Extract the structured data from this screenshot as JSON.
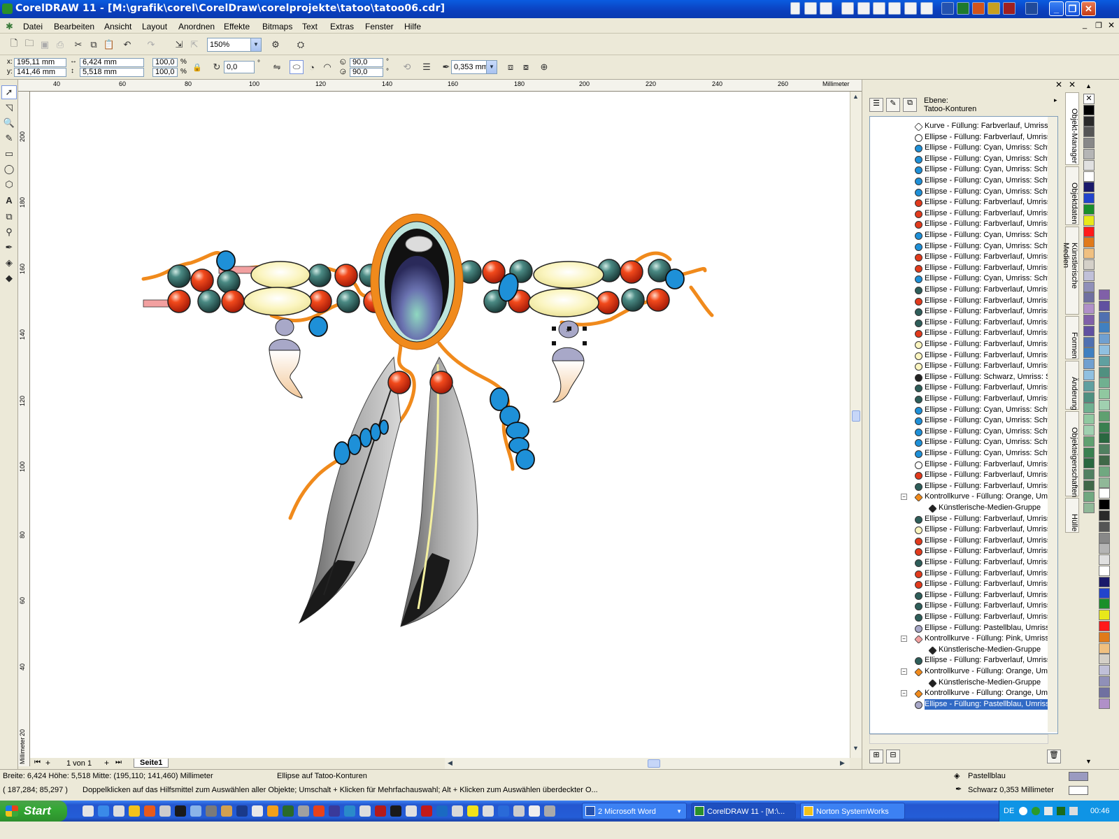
{
  "window": {
    "title": "CorelDRAW 11 - [M:\\grafik\\corel\\CorelDraw\\corelprojekte\\tatoo\\tatoo06.cdr]"
  },
  "menu": [
    "Datei",
    "Bearbeiten",
    "Ansicht",
    "Layout",
    "Anordnen",
    "Effekte",
    "Bitmaps",
    "Text",
    "Extras",
    "Fenster",
    "Hilfe"
  ],
  "toolbar": {
    "zoom": "150%",
    "x": "195,11 mm",
    "y": "141,46 mm",
    "width": "6,424 mm",
    "height": "5,518 mm",
    "scale_x": "100,0",
    "scale_y": "100,0",
    "percent": "%",
    "rotation": "0,0",
    "degree": "°",
    "arc_start": "90,0",
    "arc_end": "90,0",
    "outline_width": "0,353 mm"
  },
  "ruler": {
    "h_labels": [
      "40",
      "60",
      "80",
      "100",
      "120",
      "140",
      "160",
      "180",
      "200",
      "220",
      "240",
      "260",
      "Millimeter"
    ],
    "v_labels": [
      "200",
      "180",
      "160",
      "140",
      "120",
      "100",
      "80",
      "60",
      "40",
      "20",
      "Millimeter"
    ]
  },
  "pages": {
    "counter": "1 von 1",
    "tab": "Seite1"
  },
  "docker": {
    "layer_label": "Ebene:",
    "layer_name": "Tatoo-Konturen",
    "items": [
      {
        "text": "Kurve - Füllung: Farbverlauf, Umriss: S",
        "color": "#ffffff",
        "kind": "curve"
      },
      {
        "text": "Ellipse - Füllung: Farbverlauf, Umriss: S",
        "color": "#ffffff"
      },
      {
        "text": "Ellipse - Füllung: Cyan, Umriss: Schwarz",
        "color": "#1e90d8"
      },
      {
        "text": "Ellipse - Füllung: Cyan, Umriss: Schwarz",
        "color": "#1e90d8"
      },
      {
        "text": "Ellipse - Füllung: Cyan, Umriss: Schwarz",
        "color": "#1e90d8"
      },
      {
        "text": "Ellipse - Füllung: Cyan, Umriss: Schwarz",
        "color": "#1e90d8"
      },
      {
        "text": "Ellipse - Füllung: Cyan, Umriss: Schwarz",
        "color": "#1e90d8"
      },
      {
        "text": "Ellipse - Füllung: Farbverlauf, Umriss: S",
        "color": "#e23a1c"
      },
      {
        "text": "Ellipse - Füllung: Farbverlauf, Umriss: S",
        "color": "#e23a1c"
      },
      {
        "text": "Ellipse - Füllung: Farbverlauf, Umriss: S",
        "color": "#e23a1c"
      },
      {
        "text": "Ellipse - Füllung: Cyan, Umriss: Schwarz",
        "color": "#1e90d8"
      },
      {
        "text": "Ellipse - Füllung: Cyan, Umriss: Schwarz",
        "color": "#1e90d8"
      },
      {
        "text": "Ellipse - Füllung: Farbverlauf, Umriss: S",
        "color": "#e23a1c"
      },
      {
        "text": "Ellipse - Füllung: Farbverlauf, Umriss: S",
        "color": "#e23a1c"
      },
      {
        "text": "Ellipse - Füllung: Cyan, Umriss: Schwarz",
        "color": "#1e90d8"
      },
      {
        "text": "Ellipse - Füllung: Farbverlauf, Umriss: S",
        "color": "#2e5e5a"
      },
      {
        "text": "Ellipse - Füllung: Farbverlauf, Umriss: S",
        "color": "#e23a1c"
      },
      {
        "text": "Ellipse - Füllung: Farbverlauf, Umriss: S",
        "color": "#2e5e5a"
      },
      {
        "text": "Ellipse - Füllung: Farbverlauf, Umriss: S",
        "color": "#2e5e5a"
      },
      {
        "text": "Ellipse - Füllung: Farbverlauf, Umriss: S",
        "color": "#e23a1c"
      },
      {
        "text": "Ellipse - Füllung: Farbverlauf, Umriss: S",
        "color": "#fbf5c0"
      },
      {
        "text": "Ellipse - Füllung: Farbverlauf, Umriss: S",
        "color": "#fbf5c0"
      },
      {
        "text": "Ellipse - Füllung: Farbverlauf, Umriss: S",
        "color": "#fbf5c0"
      },
      {
        "text": "Ellipse - Füllung: Schwarz, Umriss: Schw",
        "color": "#222222"
      },
      {
        "text": "Ellipse - Füllung: Farbverlauf, Umriss: S",
        "color": "#2e5e5a"
      },
      {
        "text": "Ellipse - Füllung: Farbverlauf, Umriss: S",
        "color": "#2e5e5a"
      },
      {
        "text": "Ellipse - Füllung: Cyan, Umriss: Schwarz",
        "color": "#1e90d8"
      },
      {
        "text": "Ellipse - Füllung: Cyan, Umriss: Schwarz",
        "color": "#1e90d8"
      },
      {
        "text": "Ellipse - Füllung: Cyan, Umriss: Schwarz",
        "color": "#1e90d8"
      },
      {
        "text": "Ellipse - Füllung: Cyan, Umriss: Schwarz",
        "color": "#1e90d8"
      },
      {
        "text": "Ellipse - Füllung: Cyan, Umriss: Schwarz",
        "color": "#1e90d8"
      },
      {
        "text": "Ellipse - Füllung: Farbverlauf, Umriss: K",
        "color": "#ffffff"
      },
      {
        "text": "Ellipse - Füllung: Farbverlauf, Umriss: S",
        "color": "#e23a1c"
      },
      {
        "text": "Ellipse - Füllung: Farbverlauf, Umriss: S",
        "color": "#2e5e5a"
      },
      {
        "text": "Kontrollkurve - Füllung: Orange, Umriss",
        "color": "#f08a1c",
        "kind": "group"
      },
      {
        "text": "Künstlerische-Medien-Gruppe",
        "color": "#222222",
        "kind": "sub"
      },
      {
        "text": "Ellipse - Füllung: Farbverlauf, Umriss: S",
        "color": "#2e5e5a"
      },
      {
        "text": "Ellipse - Füllung: Farbverlauf, Umriss: S",
        "color": "#fbf5c0"
      },
      {
        "text": "Ellipse - Füllung: Farbverlauf, Umriss: S",
        "color": "#e23a1c"
      },
      {
        "text": "Ellipse - Füllung: Farbverlauf, Umriss: S",
        "color": "#e23a1c"
      },
      {
        "text": "Ellipse - Füllung: Farbverlauf, Umriss: S",
        "color": "#2e5e5a"
      },
      {
        "text": "Ellipse - Füllung: Farbverlauf, Umriss: S",
        "color": "#e23a1c"
      },
      {
        "text": "Ellipse - Füllung: Farbverlauf, Umriss: S",
        "color": "#e23a1c"
      },
      {
        "text": "Ellipse - Füllung: Farbverlauf, Umriss: S",
        "color": "#2e5e5a"
      },
      {
        "text": "Ellipse - Füllung: Farbverlauf, Umriss: S",
        "color": "#2e5e5a"
      },
      {
        "text": "Ellipse - Füllung: Farbverlauf, Umriss: S",
        "color": "#2e5e5a"
      },
      {
        "text": "Ellipse - Füllung: Pastellblau, Umriss: Sc",
        "color": "#a8a8c8"
      },
      {
        "text": "Kontrollkurve - Füllung: Pink, Umriss: Sc",
        "color": "#f0a0a0",
        "kind": "group"
      },
      {
        "text": "Künstlerische-Medien-Gruppe",
        "color": "#222222",
        "kind": "sub"
      },
      {
        "text": "Ellipse - Füllung: Farbverlauf, Umriss: S",
        "color": "#2e5e5a"
      },
      {
        "text": "Kontrollkurve - Füllung: Orange, Umriss",
        "color": "#f08a1c",
        "kind": "group"
      },
      {
        "text": "Künstlerische-Medien-Gruppe",
        "color": "#222222",
        "kind": "sub"
      },
      {
        "text": "Kontrollkurve - Füllung: Orange, Umriss",
        "color": "#f08a1c",
        "kind": "group"
      },
      {
        "text": "Ellipse - Füllung: Pastellblau, Umriss: Sc",
        "color": "#a8a8c8",
        "selected": true
      }
    ]
  },
  "dock_tabs": [
    "Objekt-Manager",
    "Objektdaten",
    "Künstlerische Medien",
    "Formen",
    "Änderung",
    "Objekteigenschaften",
    "Hülle"
  ],
  "palette": [
    "#ffffff",
    "#000000",
    "#2a2a2a",
    "#555555",
    "#888888",
    "#b5b5b5",
    "#e0e0e0",
    "#ffffff",
    "#1a1a6a",
    "#2244cc",
    "#1a8f2a",
    "#e8e81a",
    "#ff1a1a",
    "#e07a1a",
    "#f0c080",
    "#d4d0c8",
    "#c0c0d8",
    "#9090b8",
    "#7070a0",
    "#b090c8",
    "#8060a8",
    "#6050a0",
    "#5070b0",
    "#4080c0",
    "#70a0d0",
    "#90c0e0",
    "#60a0a0",
    "#509080",
    "#70b090",
    "#90c8a0",
    "#a0d0b0",
    "#60a070",
    "#3a8050",
    "#2a6840",
    "#508060",
    "#406848",
    "#70a880",
    "#90b898"
  ],
  "status": {
    "line1_left": "Breite: 6,424  Höhe: 5,518  Mitte: (195,110; 141,460) Millimeter",
    "line1_mid": "Ellipse auf Tatoo-Konturen",
    "fill_label": "Pastellblau",
    "fill_color": "#9a9ac0",
    "line2_left": "( 187,284; 85,297 )",
    "line2_hint": "Doppelklicken auf das Hilfsmittel zum Auswählen aller Objekte; Umschalt + Klicken für Mehrfachauswahl; Alt + Klicken zum Auswählen überdeckter O...",
    "outline_label": "Schwarz  0,353 Millimeter"
  },
  "taskbar": {
    "start": "Start",
    "tasks": [
      "2 Microsoft Word",
      "CorelDRAW 11 - [M:\\...",
      "Norton SystemWorks"
    ],
    "lang": "DE",
    "clock": "00:46"
  }
}
